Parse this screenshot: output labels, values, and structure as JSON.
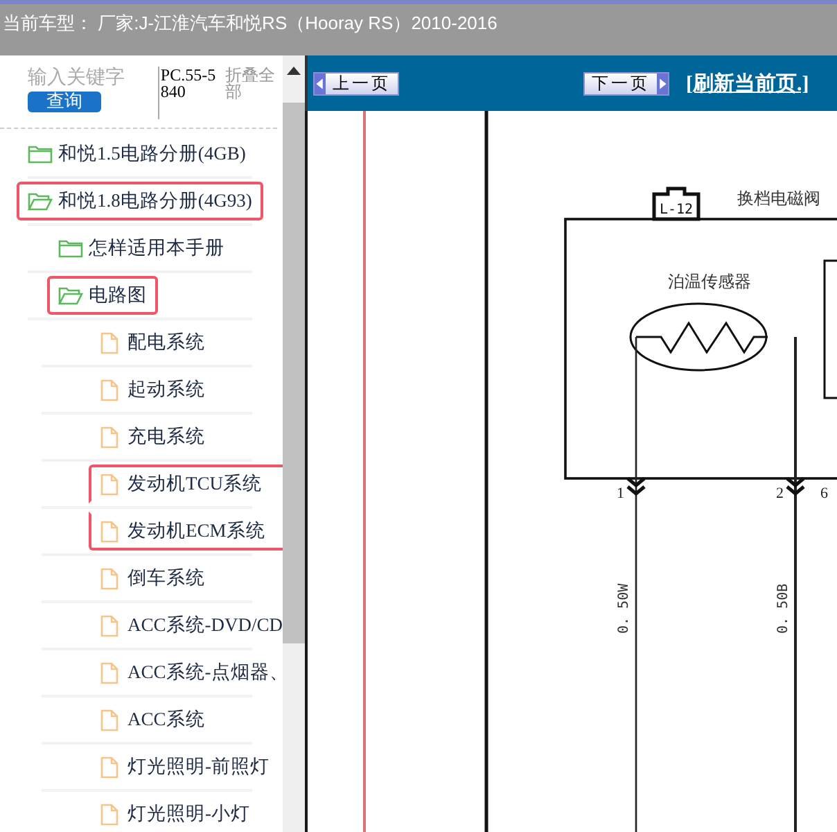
{
  "header": {
    "text": "当前车型：  厂家:J-江淮汽车和悦RS（Hooray RS）2010-2016"
  },
  "search": {
    "placeholder": "输入关键字",
    "button": "查询"
  },
  "code": "PC.55-5840",
  "collapse_all": "折叠全部",
  "tree": [
    {
      "label": "和悦1.5电路分册(4GB)",
      "kind": "folder",
      "expanded": false,
      "highlighted": false
    },
    {
      "label": "和悦1.8电路分册(4G93)",
      "kind": "folder",
      "expanded": true,
      "highlighted": true,
      "children": [
        {
          "label": "怎样适用本手册",
          "kind": "folder",
          "expanded": false,
          "highlighted": false
        },
        {
          "label": "电路图",
          "kind": "folder",
          "expanded": true,
          "highlighted": true,
          "children": [
            {
              "label": "配电系统",
              "kind": "file",
              "highlighted": false
            },
            {
              "label": "起动系统",
              "kind": "file",
              "highlighted": false
            },
            {
              "label": "充电系统",
              "kind": "file",
              "highlighted": false
            },
            {
              "label": "发动机TCU系统",
              "kind": "file",
              "highlighted": true
            },
            {
              "label": "发动机ECM系统",
              "kind": "file",
              "highlighted": true
            },
            {
              "label": "倒车系统",
              "kind": "file",
              "highlighted": false
            },
            {
              "label": "ACC系统-DVD/CD",
              "kind": "file",
              "highlighted": false
            },
            {
              "label": "ACC系统-点烟器、",
              "kind": "file",
              "highlighted": false
            },
            {
              "label": "ACC系统",
              "kind": "file",
              "highlighted": false
            },
            {
              "label": "灯光照明-前照灯",
              "kind": "file",
              "highlighted": false
            },
            {
              "label": "灯光照明-小灯",
              "kind": "file",
              "highlighted": false
            }
          ]
        }
      ]
    }
  ],
  "toolbar": {
    "prev": "上一页",
    "next": "下一页",
    "refresh": "[刷新当前页.]"
  },
  "diagram": {
    "connector": "L-12",
    "title": "换档电磁阀",
    "sensor": "泊温传感器",
    "pins": [
      "1",
      "2",
      "6"
    ],
    "wires": [
      "0. 50W",
      "0. 50B"
    ]
  }
}
